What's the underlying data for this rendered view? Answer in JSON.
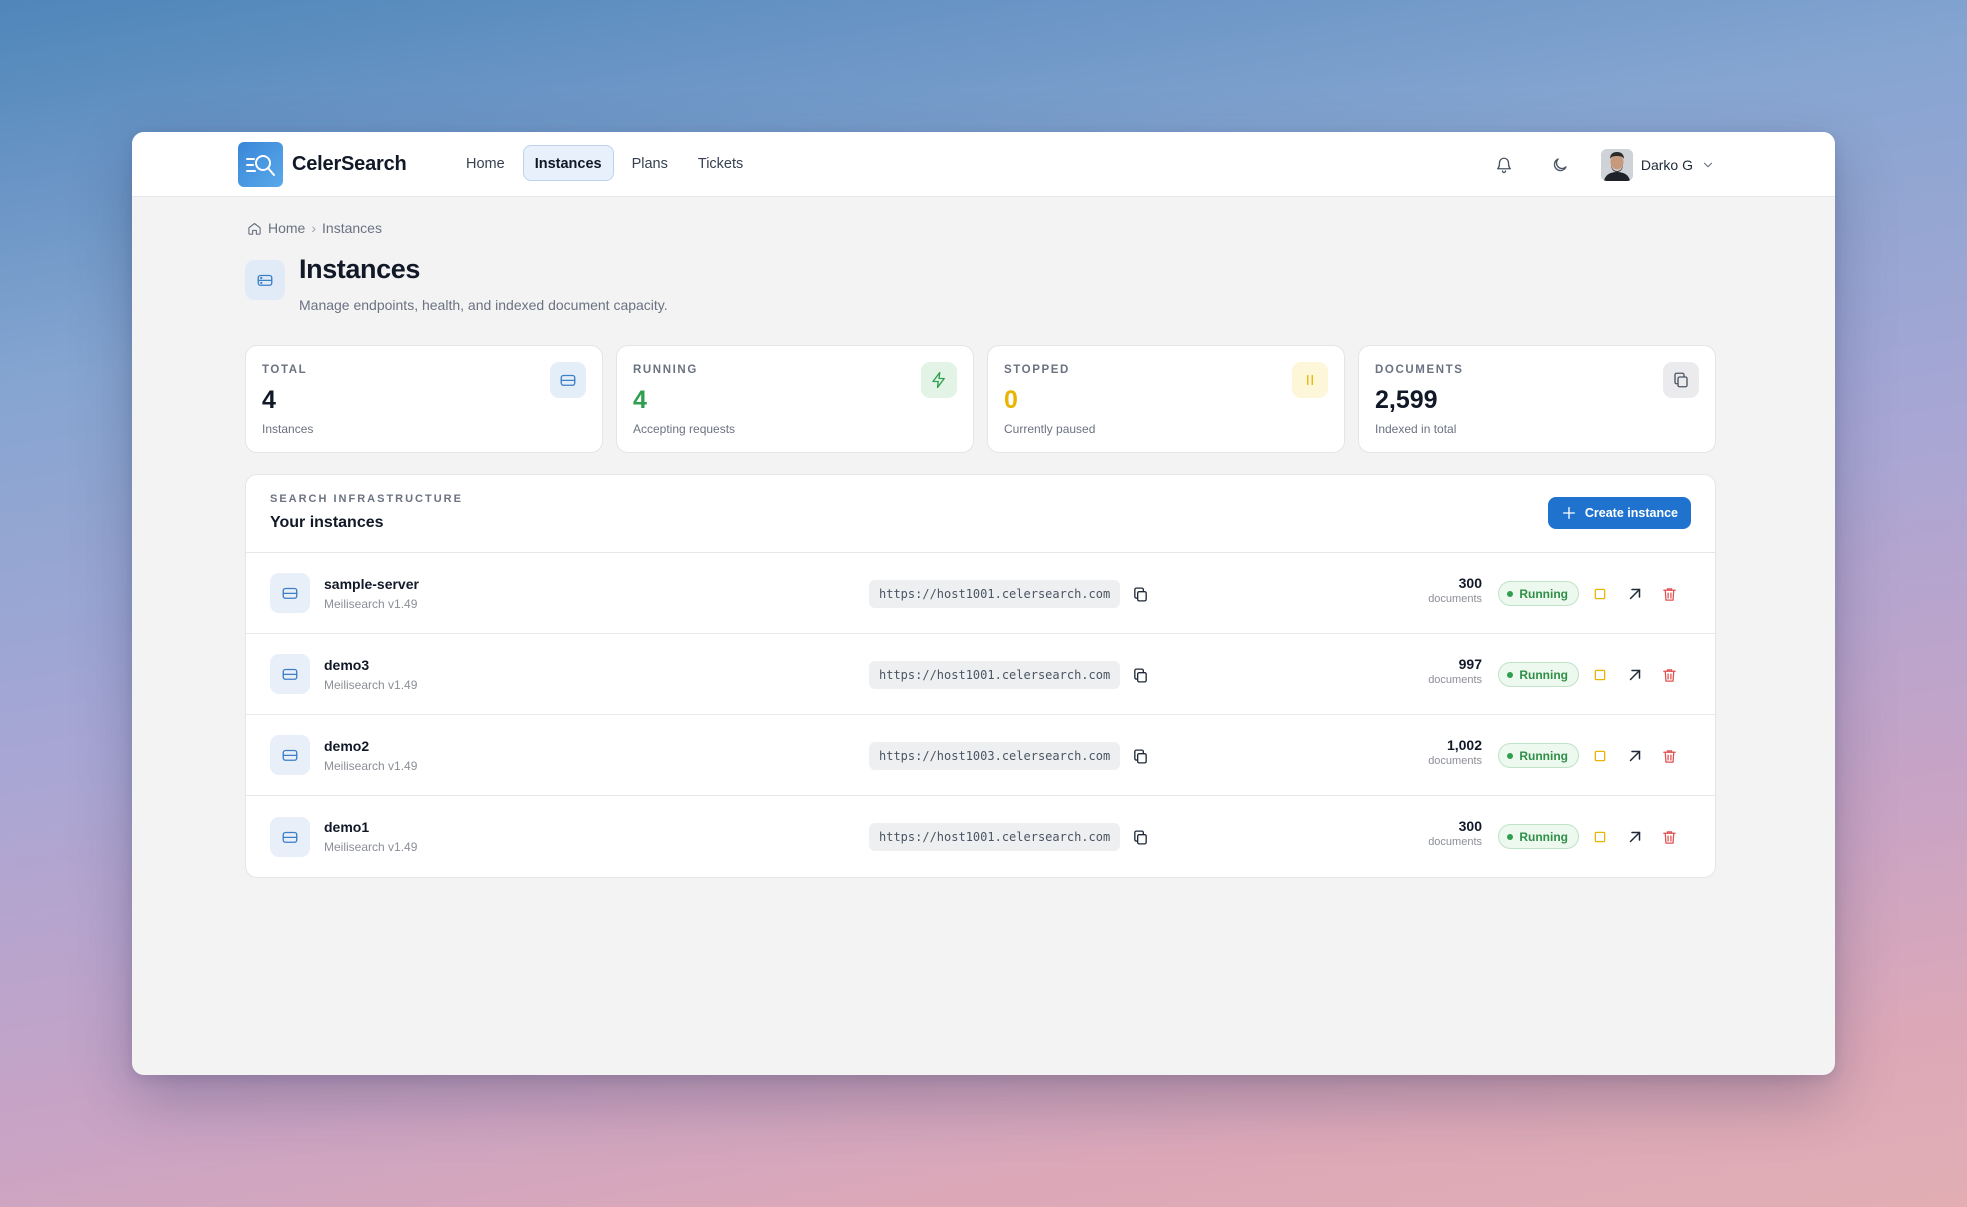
{
  "app": {
    "name": "CelerSearch"
  },
  "nav": [
    {
      "label": "Home"
    },
    {
      "label": "Instances",
      "active": true
    },
    {
      "label": "Plans"
    },
    {
      "label": "Tickets"
    }
  ],
  "header": {
    "user_name": "Darko G"
  },
  "breadcrumb": {
    "home": "Home",
    "current": "Instances"
  },
  "page": {
    "title": "Instances",
    "subtitle": "Manage endpoints, health, and indexed document capacity."
  },
  "stats": [
    {
      "label": "TOTAL",
      "value": "4",
      "sub": "Instances",
      "icon": "database-icon"
    },
    {
      "label": "RUNNING",
      "value": "4",
      "sub": "Accepting requests",
      "icon": "bolt-icon"
    },
    {
      "label": "STOPPED",
      "value": "0",
      "sub": "Currently paused",
      "icon": "pause-icon"
    },
    {
      "label": "DOCUMENTS",
      "value": "2,599",
      "sub": "Indexed in total",
      "icon": "copy-icon"
    }
  ],
  "instances_card": {
    "eyebrow": "SEARCH INFRASTRUCTURE",
    "title": "Your instances",
    "create_label": "Create instance"
  },
  "instances": [
    {
      "name": "sample-server",
      "version": "Meilisearch v1.49",
      "endpoint": "https://host1001.celersearch.com",
      "documents": "300",
      "documents_label": "documents",
      "status": "Running"
    },
    {
      "name": "demo3",
      "version": "Meilisearch v1.49",
      "endpoint": "https://host1001.celersearch.com",
      "documents": "997",
      "documents_label": "documents",
      "status": "Running"
    },
    {
      "name": "demo2",
      "version": "Meilisearch v1.49",
      "endpoint": "https://host1003.celersearch.com",
      "documents": "1,002",
      "documents_label": "documents",
      "status": "Running"
    },
    {
      "name": "demo1",
      "version": "Meilisearch v1.49",
      "endpoint": "https://host1001.celersearch.com",
      "documents": "300",
      "documents_label": "documents",
      "status": "Running"
    }
  ],
  "colors": {
    "accent": "#1f73cf",
    "running": "#2f9f4f",
    "stopped": "#e8b500",
    "danger": "#e05252"
  }
}
